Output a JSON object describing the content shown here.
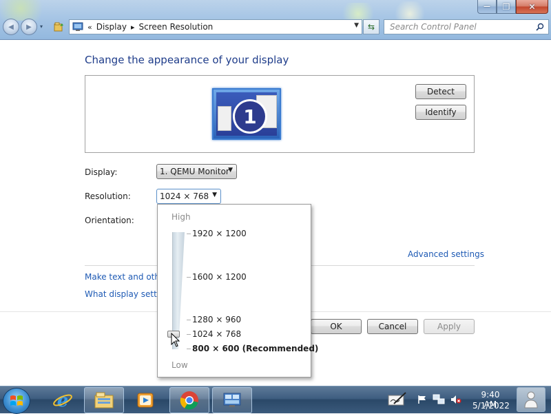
{
  "window": {
    "minimize_glyph": "—",
    "maximize_glyph": "❐",
    "close_glyph": "✕"
  },
  "nav": {
    "back_glyph": "◀",
    "forward_glyph": "▶",
    "recent_glyph": "▾",
    "breadcrumb_lead": "«",
    "breadcrumb": [
      "Display",
      "Screen Resolution"
    ],
    "breadcrumb_sep": "▸",
    "search_placeholder": "Search Control Panel"
  },
  "content": {
    "title": "Change the appearance of your display",
    "monitor_number": "1",
    "detect_label": "Detect",
    "identify_label": "Identify",
    "display_label": "Display:",
    "display_value": "1. QEMU Monitor",
    "resolution_label": "Resolution:",
    "resolution_value": "1024 × 768",
    "orientation_label": "Orientation:",
    "advanced_link": "Advanced settings",
    "make_text_link": "Make text and other items larger or smaller",
    "what_display_link": "What display settings should I choose?",
    "ok_label": "OK",
    "cancel_label": "Cancel",
    "apply_label": "Apply"
  },
  "resolution_dropdown": {
    "high_label": "High",
    "low_label": "Low",
    "options": [
      "1920 × 1200",
      "1600 × 1200",
      "1280 × 960",
      "1024 × 768",
      "800 × 600 (Recommended)"
    ],
    "selected": "1024 × 768"
  },
  "taskbar": {
    "time": "9:40 AM",
    "date": "5/1/2022"
  },
  "colors": {
    "link": "#1e5ab4",
    "title": "#1e3c8a",
    "taskbar": "#3e5d80"
  }
}
